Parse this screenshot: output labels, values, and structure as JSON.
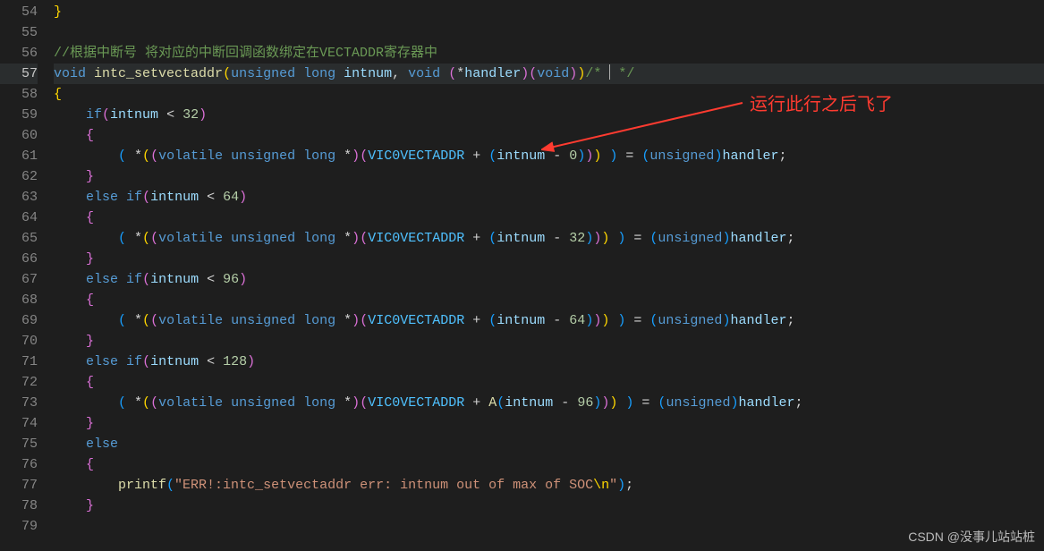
{
  "gutter": {
    "start": 54,
    "end": 79,
    "active": 57
  },
  "lines": {
    "54": [
      {
        "t": "}",
        "c": "c-paren"
      }
    ],
    "55": [],
    "56": [
      {
        "t": "//根据中断号 将对应的中断回调函数绑定在VECTADDR寄存器中",
        "c": "c-comment"
      }
    ],
    "57": [
      {
        "t": "void",
        "c": "c-kw"
      },
      {
        "t": " "
      },
      {
        "t": "intc_setvectaddr",
        "c": "c-func"
      },
      {
        "t": "(",
        "c": "c-paren"
      },
      {
        "t": "unsigned",
        "c": "c-kw"
      },
      {
        "t": " "
      },
      {
        "t": "long",
        "c": "c-kw"
      },
      {
        "t": " "
      },
      {
        "t": "intnum",
        "c": "c-param"
      },
      {
        "t": ", "
      },
      {
        "t": "void",
        "c": "c-kw"
      },
      {
        "t": " "
      },
      {
        "t": "(",
        "c": "c-paren-p"
      },
      {
        "t": "*"
      },
      {
        "t": "handler",
        "c": "c-param"
      },
      {
        "t": ")",
        "c": "c-paren-p"
      },
      {
        "t": "(",
        "c": "c-paren-p"
      },
      {
        "t": "void",
        "c": "c-kw"
      },
      {
        "t": ")",
        "c": "c-paren-p"
      },
      {
        "t": ")",
        "c": "c-paren"
      },
      {
        "t": "/* ",
        "c": "c-comment"
      },
      {
        "cursor": true
      },
      {
        "t": " */",
        "c": "c-comment"
      }
    ],
    "58": [
      {
        "t": "{",
        "c": "c-paren"
      }
    ],
    "59": [
      {
        "t": "    "
      },
      {
        "t": "if",
        "c": "c-kw"
      },
      {
        "t": "(",
        "c": "c-paren-p"
      },
      {
        "t": "intnum",
        "c": "c-param"
      },
      {
        "t": " < "
      },
      {
        "t": "32",
        "c": "c-num"
      },
      {
        "t": ")",
        "c": "c-paren-p"
      }
    ],
    "60": [
      {
        "t": "    "
      },
      {
        "t": "{",
        "c": "c-paren-p"
      }
    ],
    "61": [
      {
        "t": "        "
      },
      {
        "t": "(",
        "c": "c-paren-b"
      },
      {
        "t": " *"
      },
      {
        "t": "(",
        "c": "c-paren"
      },
      {
        "t": "(",
        "c": "c-paren-p"
      },
      {
        "t": "volatile",
        "c": "c-kw"
      },
      {
        "t": " "
      },
      {
        "t": "unsigned",
        "c": "c-kw"
      },
      {
        "t": " "
      },
      {
        "t": "long",
        "c": "c-kw"
      },
      {
        "t": " *"
      },
      {
        "t": ")",
        "c": "c-paren-p"
      },
      {
        "t": "(",
        "c": "c-paren-p"
      },
      {
        "t": "VIC0VECTADDR",
        "c": "c-const"
      },
      {
        "t": " + "
      },
      {
        "t": "(",
        "c": "c-paren-b"
      },
      {
        "t": "intnum",
        "c": "c-param"
      },
      {
        "t": " - "
      },
      {
        "t": "0",
        "c": "c-num"
      },
      {
        "t": ")",
        "c": "c-paren-b"
      },
      {
        "t": ")",
        "c": "c-paren-p"
      },
      {
        "t": ")",
        "c": "c-paren"
      },
      {
        "t": " "
      },
      {
        "t": ")",
        "c": "c-paren-b"
      },
      {
        "t": " = "
      },
      {
        "t": "(",
        "c": "c-paren-b"
      },
      {
        "t": "unsigned",
        "c": "c-kw"
      },
      {
        "t": ")",
        "c": "c-paren-b"
      },
      {
        "t": "handler",
        "c": "c-param"
      },
      {
        "t": ";"
      }
    ],
    "62": [
      {
        "t": "    "
      },
      {
        "t": "}",
        "c": "c-paren-p"
      }
    ],
    "63": [
      {
        "t": "    "
      },
      {
        "t": "else",
        "c": "c-kw"
      },
      {
        "t": " "
      },
      {
        "t": "if",
        "c": "c-kw"
      },
      {
        "t": "(",
        "c": "c-paren-p"
      },
      {
        "t": "intnum",
        "c": "c-param"
      },
      {
        "t": " < "
      },
      {
        "t": "64",
        "c": "c-num"
      },
      {
        "t": ")",
        "c": "c-paren-p"
      }
    ],
    "64": [
      {
        "t": "    "
      },
      {
        "t": "{",
        "c": "c-paren-p"
      }
    ],
    "65": [
      {
        "t": "        "
      },
      {
        "t": "(",
        "c": "c-paren-b"
      },
      {
        "t": " *"
      },
      {
        "t": "(",
        "c": "c-paren"
      },
      {
        "t": "(",
        "c": "c-paren-p"
      },
      {
        "t": "volatile",
        "c": "c-kw"
      },
      {
        "t": " "
      },
      {
        "t": "unsigned",
        "c": "c-kw"
      },
      {
        "t": " "
      },
      {
        "t": "long",
        "c": "c-kw"
      },
      {
        "t": " *"
      },
      {
        "t": ")",
        "c": "c-paren-p"
      },
      {
        "t": "(",
        "c": "c-paren-p"
      },
      {
        "t": "VIC0VECTADDR",
        "c": "c-const"
      },
      {
        "t": " + "
      },
      {
        "t": "(",
        "c": "c-paren-b"
      },
      {
        "t": "intnum",
        "c": "c-param"
      },
      {
        "t": " - "
      },
      {
        "t": "32",
        "c": "c-num"
      },
      {
        "t": ")",
        "c": "c-paren-b"
      },
      {
        "t": ")",
        "c": "c-paren-p"
      },
      {
        "t": ")",
        "c": "c-paren"
      },
      {
        "t": " "
      },
      {
        "t": ")",
        "c": "c-paren-b"
      },
      {
        "t": " = "
      },
      {
        "t": "(",
        "c": "c-paren-b"
      },
      {
        "t": "unsigned",
        "c": "c-kw"
      },
      {
        "t": ")",
        "c": "c-paren-b"
      },
      {
        "t": "handler",
        "c": "c-param"
      },
      {
        "t": ";"
      }
    ],
    "66": [
      {
        "t": "    "
      },
      {
        "t": "}",
        "c": "c-paren-p"
      }
    ],
    "67": [
      {
        "t": "    "
      },
      {
        "t": "else",
        "c": "c-kw"
      },
      {
        "t": " "
      },
      {
        "t": "if",
        "c": "c-kw"
      },
      {
        "t": "(",
        "c": "c-paren-p"
      },
      {
        "t": "intnum",
        "c": "c-param"
      },
      {
        "t": " < "
      },
      {
        "t": "96",
        "c": "c-num"
      },
      {
        "t": ")",
        "c": "c-paren-p"
      }
    ],
    "68": [
      {
        "t": "    "
      },
      {
        "t": "{",
        "c": "c-paren-p"
      }
    ],
    "69": [
      {
        "t": "        "
      },
      {
        "t": "(",
        "c": "c-paren-b"
      },
      {
        "t": " *"
      },
      {
        "t": "(",
        "c": "c-paren"
      },
      {
        "t": "(",
        "c": "c-paren-p"
      },
      {
        "t": "volatile",
        "c": "c-kw"
      },
      {
        "t": " "
      },
      {
        "t": "unsigned",
        "c": "c-kw"
      },
      {
        "t": " "
      },
      {
        "t": "long",
        "c": "c-kw"
      },
      {
        "t": " *"
      },
      {
        "t": ")",
        "c": "c-paren-p"
      },
      {
        "t": "(",
        "c": "c-paren-p"
      },
      {
        "t": "VIC0VECTADDR",
        "c": "c-const"
      },
      {
        "t": " + "
      },
      {
        "t": "(",
        "c": "c-paren-b"
      },
      {
        "t": "intnum",
        "c": "c-param"
      },
      {
        "t": " - "
      },
      {
        "t": "64",
        "c": "c-num"
      },
      {
        "t": ")",
        "c": "c-paren-b"
      },
      {
        "t": ")",
        "c": "c-paren-p"
      },
      {
        "t": ")",
        "c": "c-paren"
      },
      {
        "t": " "
      },
      {
        "t": ")",
        "c": "c-paren-b"
      },
      {
        "t": " = "
      },
      {
        "t": "(",
        "c": "c-paren-b"
      },
      {
        "t": "unsigned",
        "c": "c-kw"
      },
      {
        "t": ")",
        "c": "c-paren-b"
      },
      {
        "t": "handler",
        "c": "c-param"
      },
      {
        "t": ";"
      }
    ],
    "70": [
      {
        "t": "    "
      },
      {
        "t": "}",
        "c": "c-paren-p"
      }
    ],
    "71": [
      {
        "t": "    "
      },
      {
        "t": "else",
        "c": "c-kw"
      },
      {
        "t": " "
      },
      {
        "t": "if",
        "c": "c-kw"
      },
      {
        "t": "(",
        "c": "c-paren-p"
      },
      {
        "t": "intnum",
        "c": "c-param"
      },
      {
        "t": " < "
      },
      {
        "t": "128",
        "c": "c-num"
      },
      {
        "t": ")",
        "c": "c-paren-p"
      }
    ],
    "72": [
      {
        "t": "    "
      },
      {
        "t": "{",
        "c": "c-paren-p"
      }
    ],
    "73": [
      {
        "t": "        "
      },
      {
        "t": "(",
        "c": "c-paren-b"
      },
      {
        "t": " *"
      },
      {
        "t": "(",
        "c": "c-paren"
      },
      {
        "t": "(",
        "c": "c-paren-p"
      },
      {
        "t": "volatile",
        "c": "c-kw"
      },
      {
        "t": " "
      },
      {
        "t": "unsigned",
        "c": "c-kw"
      },
      {
        "t": " "
      },
      {
        "t": "long",
        "c": "c-kw"
      },
      {
        "t": " *"
      },
      {
        "t": ")",
        "c": "c-paren-p"
      },
      {
        "t": "(",
        "c": "c-paren-p"
      },
      {
        "t": "VIC0VECTADDR",
        "c": "c-const"
      },
      {
        "t": " + "
      },
      {
        "t": "A",
        "c": "c-func"
      },
      {
        "t": "(",
        "c": "c-paren-b"
      },
      {
        "t": "intnum",
        "c": "c-param"
      },
      {
        "t": " - "
      },
      {
        "t": "96",
        "c": "c-num"
      },
      {
        "t": ")",
        "c": "c-paren-b"
      },
      {
        "t": ")",
        "c": "c-paren-p"
      },
      {
        "t": ")",
        "c": "c-paren"
      },
      {
        "t": " "
      },
      {
        "t": ")",
        "c": "c-paren-b"
      },
      {
        "t": " = "
      },
      {
        "t": "(",
        "c": "c-paren-b"
      },
      {
        "t": "unsigned",
        "c": "c-kw"
      },
      {
        "t": ")",
        "c": "c-paren-b"
      },
      {
        "t": "handler",
        "c": "c-param"
      },
      {
        "t": ";"
      }
    ],
    "74": [
      {
        "t": "    "
      },
      {
        "t": "}",
        "c": "c-paren-p"
      }
    ],
    "75": [
      {
        "t": "    "
      },
      {
        "t": "else",
        "c": "c-kw"
      }
    ],
    "76": [
      {
        "t": "    "
      },
      {
        "t": "{",
        "c": "c-paren-p"
      }
    ],
    "77": [
      {
        "t": "        "
      },
      {
        "t": "printf",
        "c": "c-func"
      },
      {
        "t": "(",
        "c": "c-paren-b"
      },
      {
        "t": "\"ERR!:intc_setvectaddr err: intnum out of max of SOC",
        "c": "c-str"
      },
      {
        "t": "\\n",
        "c": "c-paren"
      },
      {
        "t": "\"",
        "c": "c-str"
      },
      {
        "t": ")",
        "c": "c-paren-b"
      },
      {
        "t": ";"
      }
    ],
    "78": [
      {
        "t": "    "
      },
      {
        "t": "}",
        "c": "c-paren-p"
      }
    ],
    "79": []
  },
  "annotation": "运行此行之后飞了",
  "watermark": "CSDN @没事儿站站桩"
}
